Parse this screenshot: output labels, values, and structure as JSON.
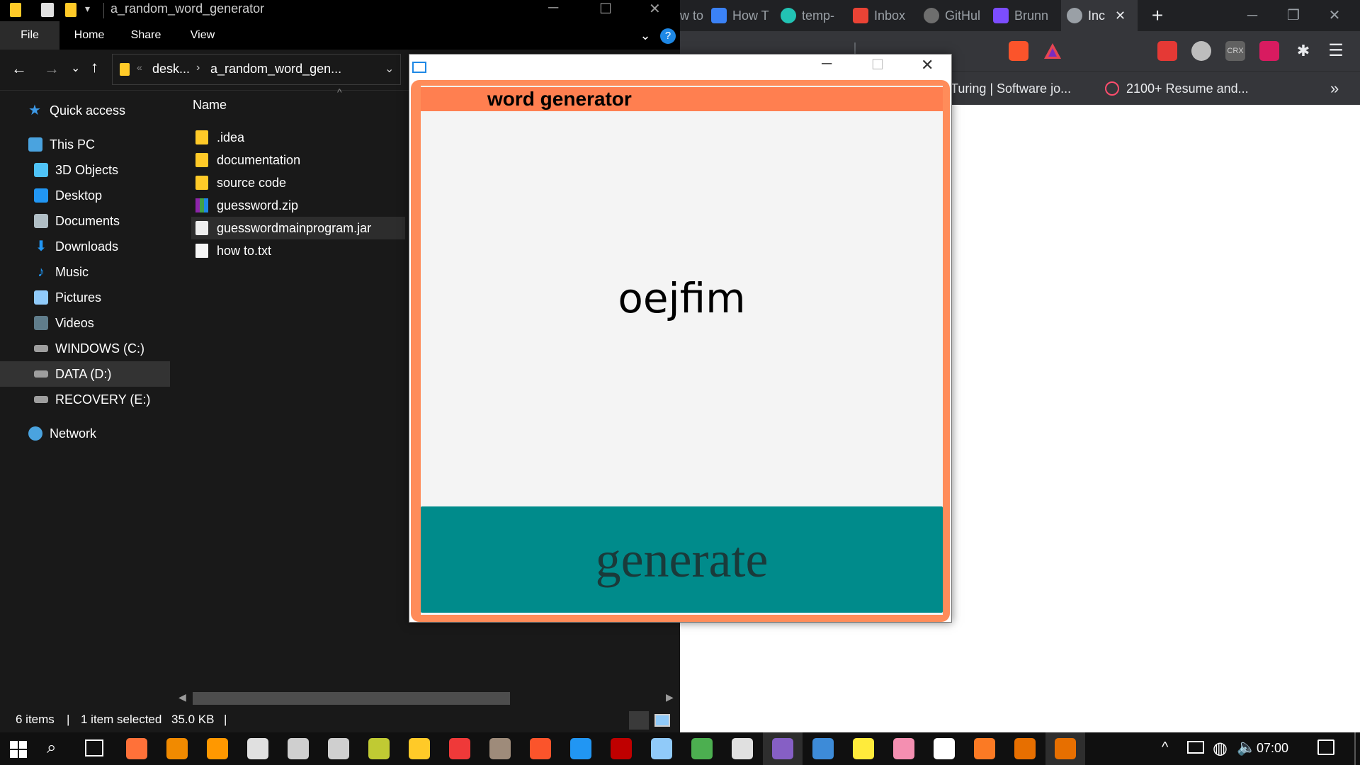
{
  "browser": {
    "tabs": [
      {
        "label": "w to",
        "icon": "partial-tab-icon",
        "color": "#5f6368"
      },
      {
        "label": "How T",
        "icon": "z-logo-icon",
        "color": "#3b82f6"
      },
      {
        "label": "temp-",
        "icon": "temp-mail-icon",
        "color": "#22c3b4"
      },
      {
        "label": "Inbox",
        "icon": "gmail-icon",
        "color": "#ea4335"
      },
      {
        "label": "GitHul",
        "icon": "github-icon",
        "color": "#6e6e6e"
      },
      {
        "label": "Brunn",
        "icon": "t-logo-icon",
        "color": "#7c4dff"
      },
      {
        "label": "Inc",
        "icon": "globe-icon",
        "color": "#9aa0a6"
      }
    ],
    "bookmarks": [
      {
        "label": "Turing | Software jo...",
        "icon": "turing-icon"
      },
      {
        "label": "2100+ Resume and...",
        "icon": "resume-icon"
      }
    ],
    "bookmarks_more": "»"
  },
  "explorer": {
    "title": "a_random_word_generator",
    "ribbon": [
      "File",
      "Home",
      "Share",
      "View"
    ],
    "address": {
      "part1": "desk...",
      "part2": "a_random_word_gen..."
    },
    "column_header": "Name",
    "sidebar": [
      {
        "label": "Quick access",
        "icon": "star-icon",
        "color": "#3d9ae8"
      },
      {
        "label": "This PC",
        "icon": "computer-icon",
        "color": "#4aa3df"
      },
      {
        "label": "3D Objects",
        "icon": "cube-icon",
        "color": "#4fc3f7"
      },
      {
        "label": "Desktop",
        "icon": "desktop-icon",
        "color": "#2196f3"
      },
      {
        "label": "Documents",
        "icon": "documents-icon",
        "color": "#b0bec5"
      },
      {
        "label": "Downloads",
        "icon": "downloads-icon",
        "color": "#2196f3"
      },
      {
        "label": "Music",
        "icon": "music-icon",
        "color": "#2196f3"
      },
      {
        "label": "Pictures",
        "icon": "pictures-icon",
        "color": "#90caf9"
      },
      {
        "label": "Videos",
        "icon": "videos-icon",
        "color": "#607d8b"
      },
      {
        "label": "WINDOWS (C:)",
        "icon": "drive-c-icon",
        "color": "#9e9e9e"
      },
      {
        "label": "DATA (D:)",
        "icon": "drive-d-icon",
        "color": "#9e9e9e"
      },
      {
        "label": "RECOVERY (E:)",
        "icon": "drive-e-icon",
        "color": "#9e9e9e"
      },
      {
        "label": "Network",
        "icon": "network-icon",
        "color": "#4aa3df"
      }
    ],
    "files": [
      {
        "name": ".idea",
        "icon": "folder-icon"
      },
      {
        "name": "documentation",
        "icon": "folder-icon"
      },
      {
        "name": "source code",
        "icon": "folder-icon"
      },
      {
        "name": "guessword.zip",
        "icon": "zip-archive-icon"
      },
      {
        "name": "guesswordmainprogram.jar",
        "icon": "java-jar-icon"
      },
      {
        "name": "how to.txt",
        "icon": "text-file-icon"
      }
    ],
    "status": {
      "items": "6 items",
      "selected": "1 item selected",
      "size": "35.0 KB"
    }
  },
  "app": {
    "header": "word generator",
    "word": "oejfim",
    "button": "generate",
    "colors": {
      "frame": "#ff8c5a",
      "header": "#ff7f50",
      "button": "#008b8b"
    }
  },
  "taskbar": {
    "clock": "07:00",
    "apps": [
      {
        "icon": "firefox-icon",
        "color": "#ff7139"
      },
      {
        "icon": "vlc-icon",
        "color": "#f18a00"
      },
      {
        "icon": "sublime-icon",
        "color": "#ff9800"
      },
      {
        "icon": "fox-icon",
        "color": "#e0e0e0"
      },
      {
        "icon": "obs-icon",
        "color": "#cfcfcf"
      },
      {
        "icon": "terminal-icon",
        "color": "#cfcfcf"
      },
      {
        "icon": "xampp-wrench-icon",
        "color": "#c0ca33"
      },
      {
        "icon": "file-explorer-icon",
        "color": "#ffca28"
      },
      {
        "icon": "vivaldi-icon",
        "color": "#ef3939"
      },
      {
        "icon": "gimp-icon",
        "color": "#9e8b7a"
      },
      {
        "icon": "brave-icon",
        "color": "#fb542b"
      },
      {
        "icon": "vscode-icon",
        "color": "#2196f3"
      },
      {
        "icon": "filezilla-icon",
        "color": "#bf0000"
      },
      {
        "icon": "virtualbox-icon",
        "color": "#90caf9"
      },
      {
        "icon": "refresh-ring-icon",
        "color": "#4caf50"
      },
      {
        "icon": "inkscape-icon",
        "color": "#e0e0e0"
      },
      {
        "icon": "visual-studio-icon",
        "color": "#865fc5"
      },
      {
        "icon": "edge-like-icon",
        "color": "#3d8bd8"
      },
      {
        "icon": "media-player-icon",
        "color": "#ffeb3b"
      },
      {
        "icon": "intellij-icon",
        "color": "#f48fb1"
      },
      {
        "icon": "document-icon",
        "color": "#ffffff"
      },
      {
        "icon": "xampp-icon",
        "color": "#fb7a24"
      },
      {
        "icon": "java-icon",
        "color": "#e76f00"
      },
      {
        "icon": "java-app-icon",
        "color": "#e76f00"
      }
    ]
  }
}
